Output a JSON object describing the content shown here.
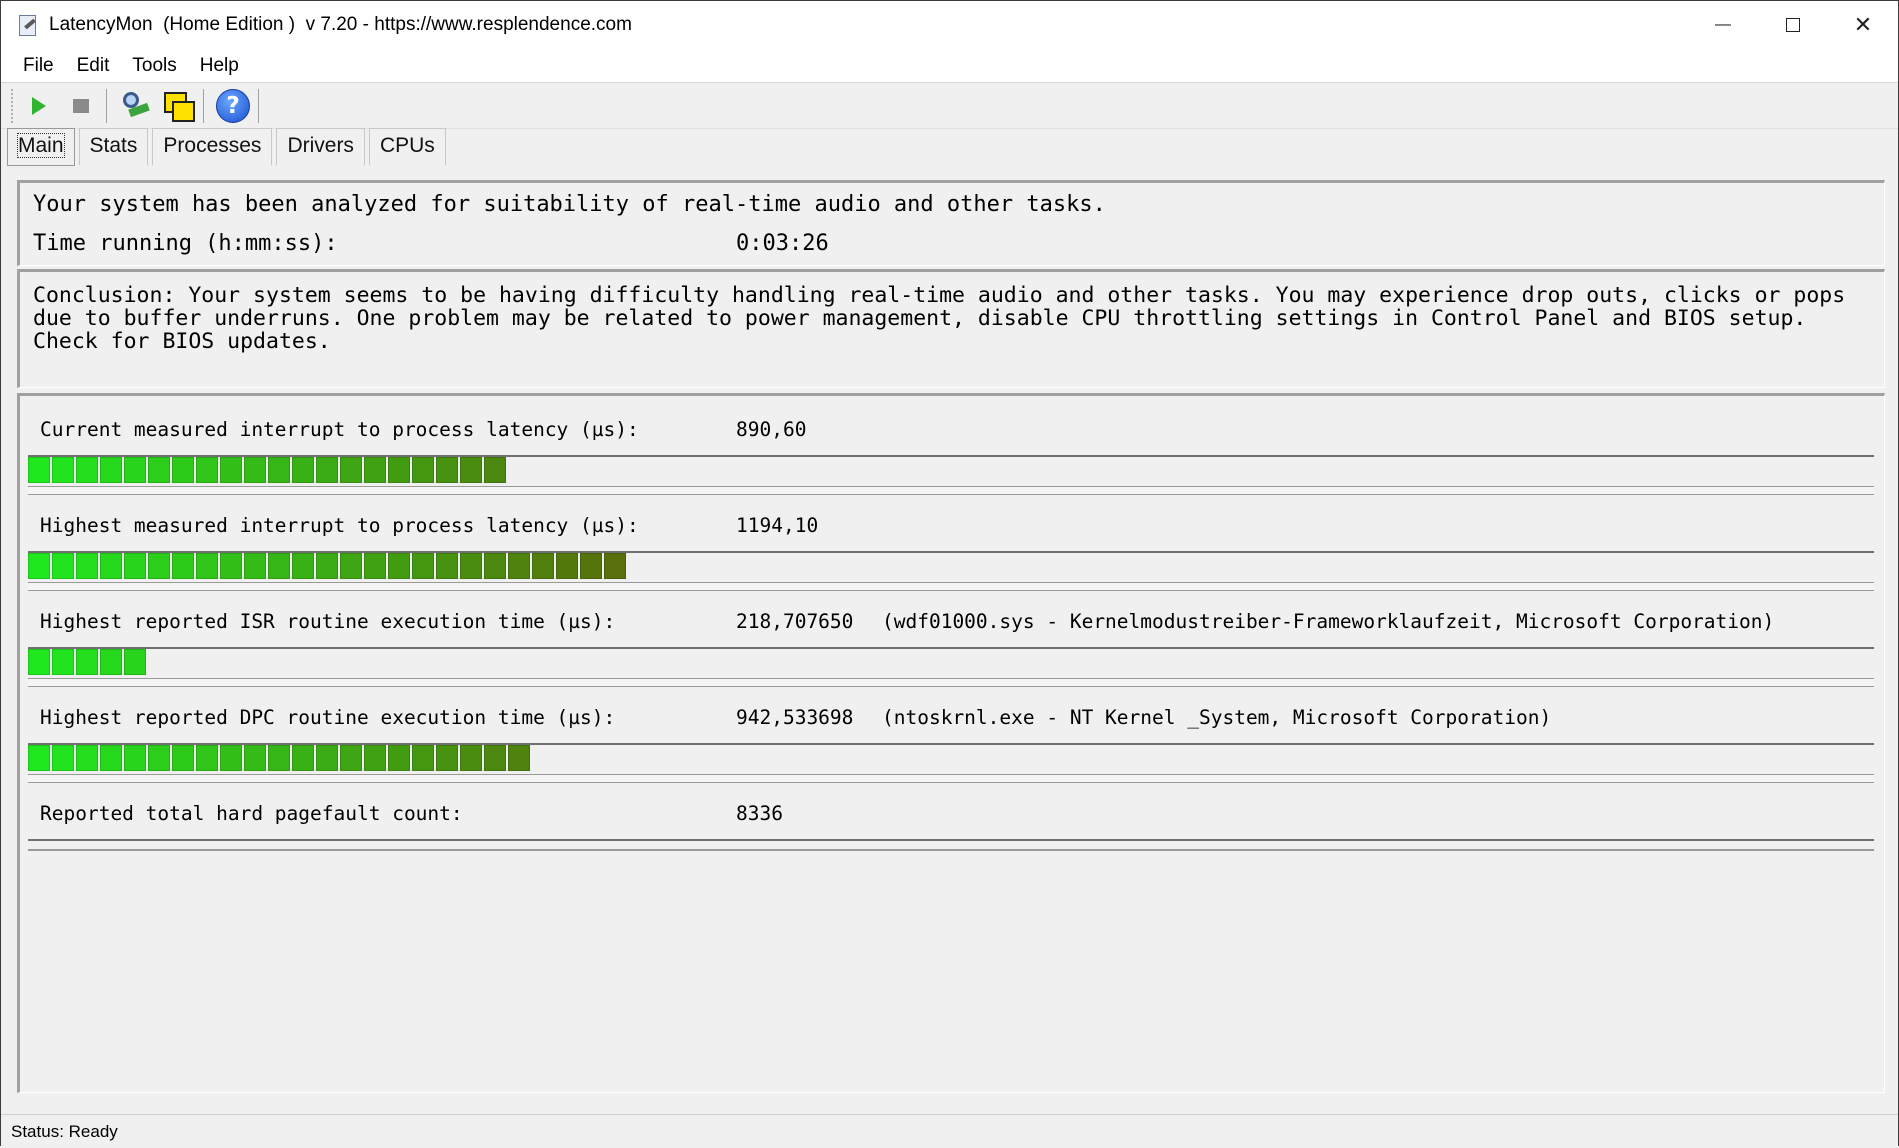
{
  "window": {
    "title": "LatencyMon  (Home Edition )  v 7.20 - https://www.resplendence.com",
    "minimize_glyph": "—",
    "close_glyph": "✕"
  },
  "menu": [
    "File",
    "Edit",
    "Tools",
    "Help"
  ],
  "toolbar": {
    "icons": [
      "play-icon",
      "stop-icon",
      "inspect-icon",
      "windows-icon",
      "help-icon"
    ],
    "help_glyph": "?"
  },
  "tabs": [
    "Main",
    "Stats",
    "Processes",
    "Drivers",
    "CPUs"
  ],
  "active_tab": "Main",
  "summary": {
    "analyzed_text": "Your system has been analyzed for suitability of real-time audio and other tasks.",
    "time_label": "Time running (h:mm:ss):",
    "time_value": "0:03:26"
  },
  "conclusion": "Conclusion: Your system seems to be having difficulty handling real-time audio and other tasks. You may experience drop outs, clicks or pops due to buffer underruns. One problem may be related to power management, disable CPU throttling settings in Control Panel and BIOS setup. Check for BIOS updates.",
  "metrics": [
    {
      "label": "Current measured interrupt to process latency (µs):",
      "value": "890,60",
      "detail": "",
      "segments": 20
    },
    {
      "label": "Highest measured interrupt to process latency (µs):",
      "value": "1194,10",
      "detail": "",
      "segments": 25
    },
    {
      "label": "Highest reported ISR routine execution time (µs):",
      "value": "218,707650",
      "detail": "(wdf01000.sys - Kernelmodustreiber-Frameworklaufzeit, Microsoft Corporation)",
      "segments": 5
    },
    {
      "label": "Highest reported DPC routine execution time (µs):",
      "value": "942,533698",
      "detail": "(ntoskrnl.exe - NT Kernel _System, Microsoft Corporation)",
      "segments": 21
    },
    {
      "label": "Reported total hard pagefault count:",
      "value": "8336",
      "detail": "",
      "segments": 0
    }
  ],
  "colors": {
    "bar_start": "#1fe81f",
    "bar_end": "#5a6a0a"
  },
  "status": "Status: Ready"
}
